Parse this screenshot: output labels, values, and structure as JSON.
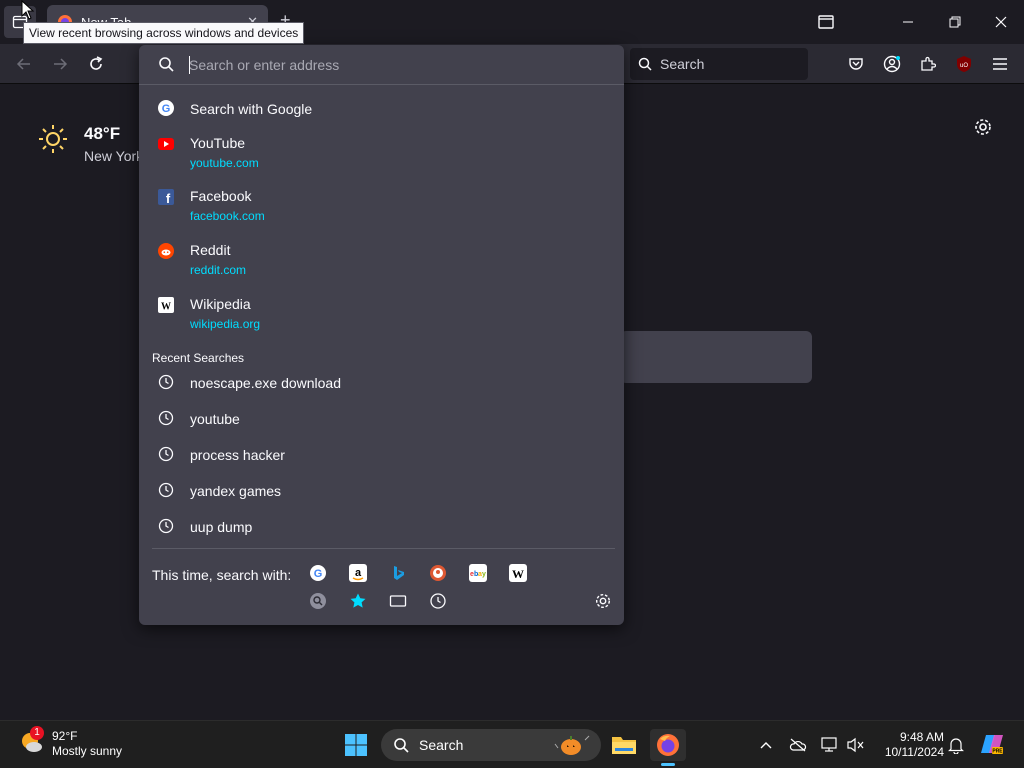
{
  "tabstrip": {
    "tab_title": "New Tab",
    "tooltip": "View recent browsing across windows and devices",
    "new_tab_symbol": "+"
  },
  "toolbar": {
    "search_placeholder": "Search"
  },
  "newtab": {
    "weather_temp": "48°F",
    "weather_city": "New York"
  },
  "urlbar": {
    "placeholder": "Search or enter address",
    "search_with": "Search with Google",
    "suggestions": [
      {
        "title": "YouTube",
        "url": "youtube.com",
        "icon": "youtube-icon"
      },
      {
        "title": "Facebook",
        "url": "facebook.com",
        "icon": "facebook-icon"
      },
      {
        "title": "Reddit",
        "url": "reddit.com",
        "icon": "reddit-icon"
      },
      {
        "title": "Wikipedia",
        "url": "wikipedia.org",
        "icon": "wikipedia-icon"
      }
    ],
    "recent_heading": "Recent Searches",
    "recent": [
      "noescape.exe download",
      "youtube",
      "process hacker",
      "yandex games",
      "uup dump"
    ],
    "onetime_label": "This time, search with:",
    "engines": [
      "google-icon",
      "amazon-icon",
      "bing-icon",
      "duckduckgo-icon",
      "ebay-icon",
      "wikipedia-icon"
    ],
    "modes": [
      "search-icon",
      "bookmarks-icon",
      "tabs-icon",
      "history-icon"
    ]
  },
  "taskbar": {
    "weather_temp": "92°F",
    "weather_desc": "Mostly sunny",
    "weather_badge": "1",
    "search_label": "Search",
    "time": "9:48 AM",
    "date": "10/11/2024"
  },
  "colors": {
    "accent_url": "#00ddff",
    "popup_bg": "#42414d",
    "page_bg": "#1c1b22"
  }
}
